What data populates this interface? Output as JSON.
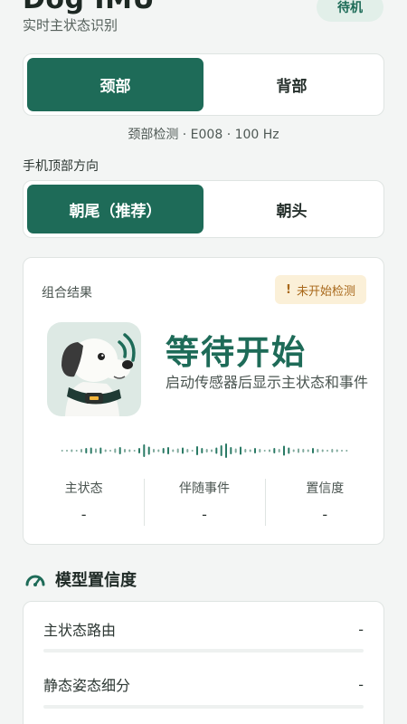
{
  "header": {
    "title": "Dog IMU",
    "subtitle": "实时主状态识别",
    "status_pill": "待机"
  },
  "position_selector": {
    "options": [
      "颈部",
      "背部"
    ],
    "selected": "颈部"
  },
  "detect_info": "颈部检测 · E008 · 100 Hz",
  "orientation": {
    "label": "手机顶部方向",
    "options": [
      "朝尾（推荐）",
      "朝头"
    ],
    "selected": "朝尾（推荐）"
  },
  "result": {
    "label": "组合结果",
    "badge": "未开始检测",
    "badge_icon": "!",
    "state": "等待开始",
    "description": "启动传感器后显示主状态和事件",
    "accent": "#1e6b58",
    "metrics": [
      {
        "label": "主状态",
        "value": "-"
      },
      {
        "label": "伴随事件",
        "value": "-"
      },
      {
        "label": "置信度",
        "value": "-"
      }
    ]
  },
  "confidence": {
    "icon": "gauge-icon",
    "title": "模型置信度",
    "rows": [
      {
        "label": "主状态路由",
        "value": "-"
      },
      {
        "label": "静态姿态细分",
        "value": "-"
      }
    ]
  }
}
